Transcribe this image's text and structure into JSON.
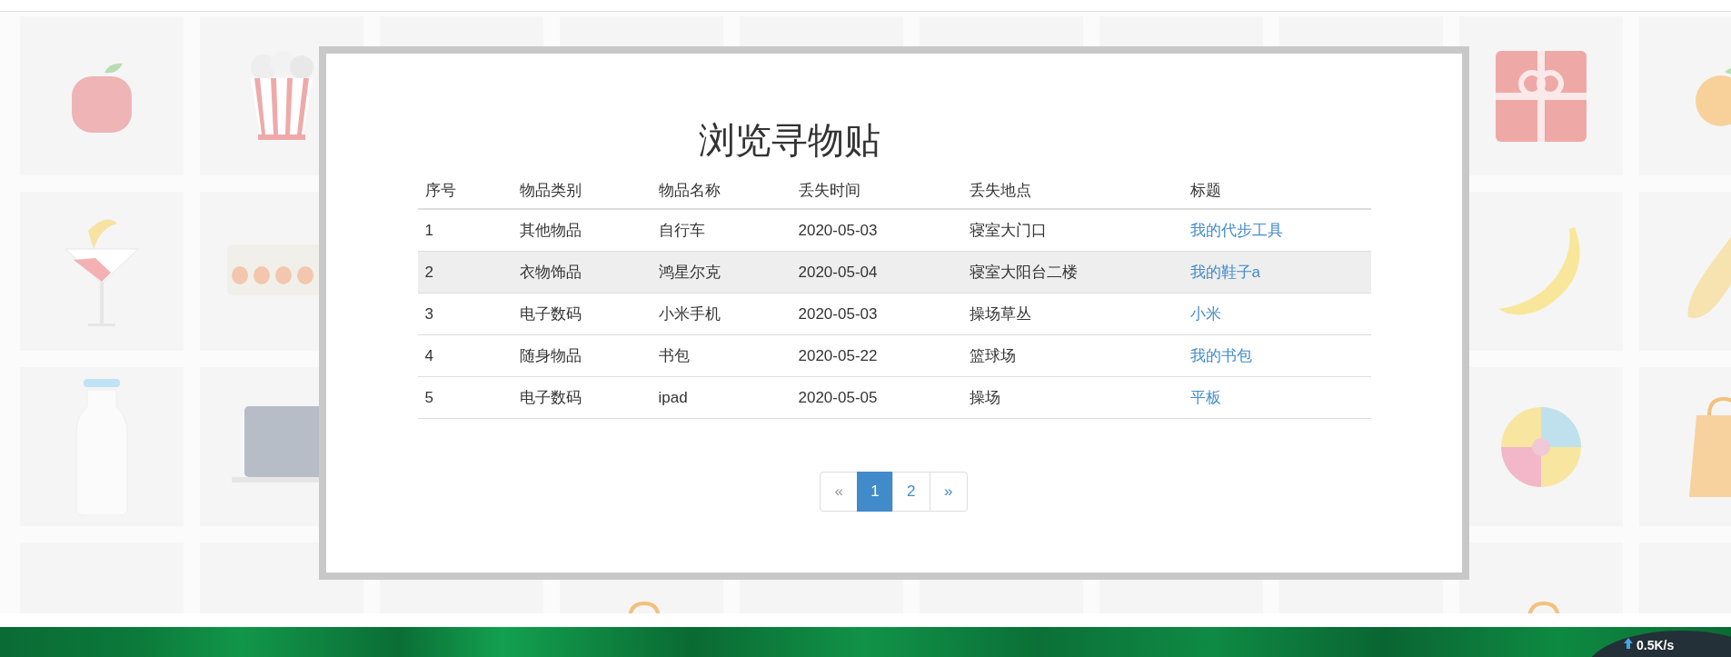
{
  "panel": {
    "title": "浏览寻物贴",
    "table": {
      "columns": [
        "序号",
        "物品类别",
        "物品名称",
        "丢失时间",
        "丢失地点",
        "标题"
      ],
      "rows": [
        {
          "cells": [
            "1",
            "其他物品",
            "自行车",
            "2020-05-03",
            "寝室大门口"
          ],
          "link": "我的代步工具",
          "highlighted": false
        },
        {
          "cells": [
            "2",
            "衣物饰品",
            "鸿星尔克",
            "2020-05-04",
            "寝室大阳台二楼"
          ],
          "link": "我的鞋子a",
          "highlighted": true
        },
        {
          "cells": [
            "3",
            "电子数码",
            "小米手机",
            "2020-05-03",
            "操场草丛"
          ],
          "link": "小米",
          "highlighted": false
        },
        {
          "cells": [
            "4",
            "随身物品",
            "书包",
            "2020-05-22",
            "篮球场"
          ],
          "link": "我的书包",
          "highlighted": false
        },
        {
          "cells": [
            "5",
            "电子数码",
            "ipad",
            "2020-05-05",
            "操场"
          ],
          "link": "平板",
          "highlighted": false
        }
      ]
    },
    "pagination": [
      {
        "label": "«",
        "selected": false,
        "disabled": true
      },
      {
        "label": "1",
        "selected": true,
        "disabled": false
      },
      {
        "label": "2",
        "selected": false,
        "disabled": false
      },
      {
        "label": "»",
        "selected": false,
        "disabled": false
      }
    ]
  },
  "taskbar": {
    "speed_widget": {
      "reading": "0.5K/s"
    }
  }
}
